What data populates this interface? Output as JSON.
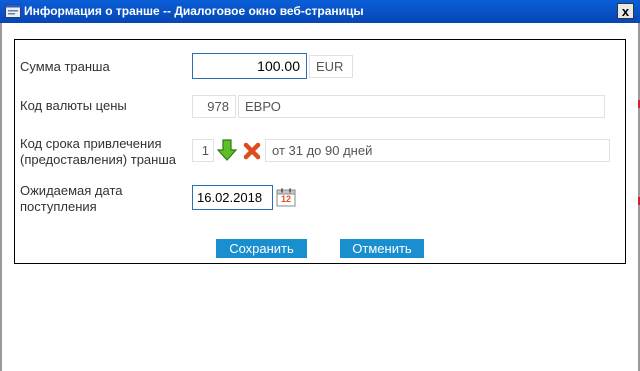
{
  "window": {
    "title": "Информация о транше -- Диалоговое окно веб-страницы",
    "close_glyph": "x"
  },
  "form": {
    "amount": {
      "label": "Сумма транша",
      "value": "100.00",
      "currency": "EUR"
    },
    "currency_code": {
      "label": "Код валюты цены",
      "code": "978",
      "name": "ЕВРО"
    },
    "term_code": {
      "label_line1": "Код срока привлечения",
      "label_line2": "(предоставления) транша",
      "code": "1",
      "description": "от 31 до 90 дней"
    },
    "expected_date": {
      "label_line1": "Ожидаемая дата",
      "label_line2": "поступления",
      "value": "16.02.2018",
      "calendar_day": "12"
    }
  },
  "buttons": {
    "save": "Сохранить",
    "cancel": "Отменить"
  },
  "colors": {
    "accent": "#1a8fd0",
    "titlebar": "#0a5fd8",
    "focus_border": "#2a6fb5"
  }
}
